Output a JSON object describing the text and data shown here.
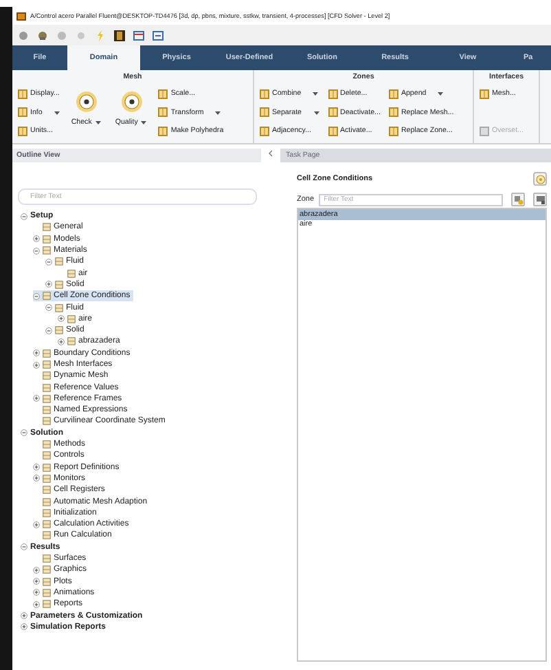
{
  "window": {
    "title": "A/Control acero Parallel Fluent@DESKTOP-TD4476 [3d, dp, pbns, mixture, sstkw, transient, 4-processes] [CFD Solver - Level 2]"
  },
  "tabs": [
    {
      "label": "File",
      "selected": false
    },
    {
      "label": "Domain",
      "selected": true
    },
    {
      "label": "Physics",
      "selected": false
    },
    {
      "label": "User-Defined",
      "selected": false
    },
    {
      "label": "Solution",
      "selected": false
    },
    {
      "label": "Results",
      "selected": false
    },
    {
      "label": "View",
      "selected": false
    },
    {
      "label": "Pa",
      "selected": false
    }
  ],
  "ribbon": [
    {
      "title": "Mesh",
      "columns": [
        {
          "kind": "small",
          "items": [
            {
              "label": "Display...",
              "dropdown": false,
              "disabled": false
            },
            {
              "label": "Info",
              "dropdown": true,
              "disabled": false
            },
            {
              "label": "Units...",
              "dropdown": false,
              "disabled": false
            }
          ]
        },
        {
          "kind": "large",
          "items": [
            {
              "label": "Check",
              "dropdown": true,
              "disabled": false
            }
          ]
        },
        {
          "kind": "large",
          "items": [
            {
              "label": "Quality",
              "dropdown": true,
              "disabled": false
            }
          ]
        },
        {
          "kind": "small",
          "items": [
            {
              "label": "Scale...",
              "dropdown": false,
              "disabled": false
            },
            {
              "label": "Transform",
              "dropdown": true,
              "disabled": false
            },
            {
              "label": "Make Polyhedra",
              "dropdown": false,
              "disabled": false
            }
          ]
        }
      ]
    },
    {
      "title": "Zones",
      "columns": [
        {
          "kind": "small",
          "items": [
            {
              "label": "Combine",
              "dropdown": true,
              "disabled": false
            },
            {
              "label": "Separate",
              "dropdown": true,
              "disabled": false
            },
            {
              "label": "Adjacency...",
              "dropdown": false,
              "disabled": false
            }
          ]
        },
        {
          "kind": "small",
          "items": [
            {
              "label": "Delete...",
              "dropdown": false,
              "disabled": false
            },
            {
              "label": "Deactivate...",
              "dropdown": false,
              "disabled": false
            },
            {
              "label": "Activate...",
              "dropdown": false,
              "disabled": false
            }
          ]
        },
        {
          "kind": "small",
          "items": [
            {
              "label": "Append",
              "dropdown": true,
              "disabled": false
            },
            {
              "label": "Replace Mesh...",
              "dropdown": false,
              "disabled": false
            },
            {
              "label": "Replace Zone...",
              "dropdown": false,
              "disabled": false
            }
          ]
        }
      ]
    },
    {
      "title": "Interfaces",
      "columns": [
        {
          "kind": "small",
          "items": [
            {
              "label": "Mesh...",
              "dropdown": false,
              "disabled": false
            },
            {
              "label": "Overset...",
              "dropdown": false,
              "disabled": true
            }
          ]
        }
      ]
    }
  ],
  "outline": {
    "title": "Outline View",
    "filter": {
      "placeholder": "Filter Text"
    },
    "tree": [
      {
        "label": "Setup",
        "kind": "category",
        "expanded": true,
        "selected": false,
        "children": [
          {
            "label": "General",
            "kind": "item",
            "selected": false
          },
          {
            "label": "Models",
            "kind": "item",
            "expanded": false,
            "selected": false
          },
          {
            "label": "Materials",
            "kind": "item",
            "expanded": true,
            "selected": false,
            "children": [
              {
                "label": "Fluid",
                "kind": "item",
                "expanded": true,
                "selected": false,
                "children": [
                  {
                    "label": "air",
                    "kind": "item",
                    "selected": false
                  }
                ]
              },
              {
                "label": "Solid",
                "kind": "item",
                "expanded": false,
                "selected": false
              }
            ]
          },
          {
            "label": "Cell Zone Conditions",
            "kind": "item",
            "expanded": true,
            "selected": true,
            "children": [
              {
                "label": "Fluid",
                "kind": "item",
                "expanded": true,
                "selected": false,
                "children": [
                  {
                    "label": "aire",
                    "kind": "item",
                    "expanded": false,
                    "selected": false
                  }
                ]
              },
              {
                "label": "Solid",
                "kind": "item",
                "expanded": true,
                "selected": false,
                "children": [
                  {
                    "label": "abrazadera",
                    "kind": "item",
                    "expanded": false,
                    "selected": false
                  }
                ]
              }
            ]
          },
          {
            "label": "Boundary Conditions",
            "kind": "item",
            "expanded": false,
            "selected": false
          },
          {
            "label": "Mesh Interfaces",
            "kind": "item",
            "expanded": false,
            "selected": false
          },
          {
            "label": "Dynamic Mesh",
            "kind": "item",
            "selected": false
          },
          {
            "label": "Reference Values",
            "kind": "item",
            "selected": false
          },
          {
            "label": "Reference Frames",
            "kind": "item",
            "expanded": false,
            "selected": false
          },
          {
            "label": "Named Expressions",
            "kind": "item",
            "selected": false
          },
          {
            "label": "Curvilinear Coordinate System",
            "kind": "item",
            "selected": false
          }
        ]
      },
      {
        "label": "Solution",
        "kind": "category",
        "expanded": true,
        "selected": false,
        "children": [
          {
            "label": "Methods",
            "kind": "item",
            "selected": false
          },
          {
            "label": "Controls",
            "kind": "item",
            "selected": false
          },
          {
            "label": "Report Definitions",
            "kind": "item",
            "expanded": false,
            "selected": false
          },
          {
            "label": "Monitors",
            "kind": "item",
            "expanded": false,
            "selected": false
          },
          {
            "label": "Cell Registers",
            "kind": "item",
            "selected": false
          },
          {
            "label": "Automatic Mesh Adaption",
            "kind": "item",
            "selected": false
          },
          {
            "label": "Initialization",
            "kind": "item",
            "selected": false
          },
          {
            "label": "Calculation Activities",
            "kind": "item",
            "expanded": false,
            "selected": false
          },
          {
            "label": "Run Calculation",
            "kind": "item",
            "selected": false
          }
        ]
      },
      {
        "label": "Results",
        "kind": "category",
        "expanded": true,
        "selected": false,
        "children": [
          {
            "label": "Surfaces",
            "kind": "item",
            "selected": false
          },
          {
            "label": "Graphics",
            "kind": "item",
            "expanded": false,
            "selected": false
          },
          {
            "label": "Plots",
            "kind": "item",
            "expanded": false,
            "selected": false
          },
          {
            "label": "Animations",
            "kind": "item",
            "expanded": false,
            "selected": false
          },
          {
            "label": "Reports",
            "kind": "item",
            "expanded": false,
            "selected": false
          }
        ]
      },
      {
        "label": "Parameters & Customization",
        "kind": "category",
        "expanded": false,
        "selected": false
      },
      {
        "label": "Simulation Reports",
        "kind": "category",
        "expanded": false,
        "selected": false
      }
    ]
  },
  "task_page": {
    "title": "Task Page",
    "heading": "Cell Zone Conditions",
    "zone_label": "Zone",
    "filter": {
      "placeholder": "Filter Text"
    },
    "zones": [
      {
        "label": "abrazadera",
        "selected": true
      },
      {
        "label": "aire",
        "selected": false
      }
    ]
  }
}
